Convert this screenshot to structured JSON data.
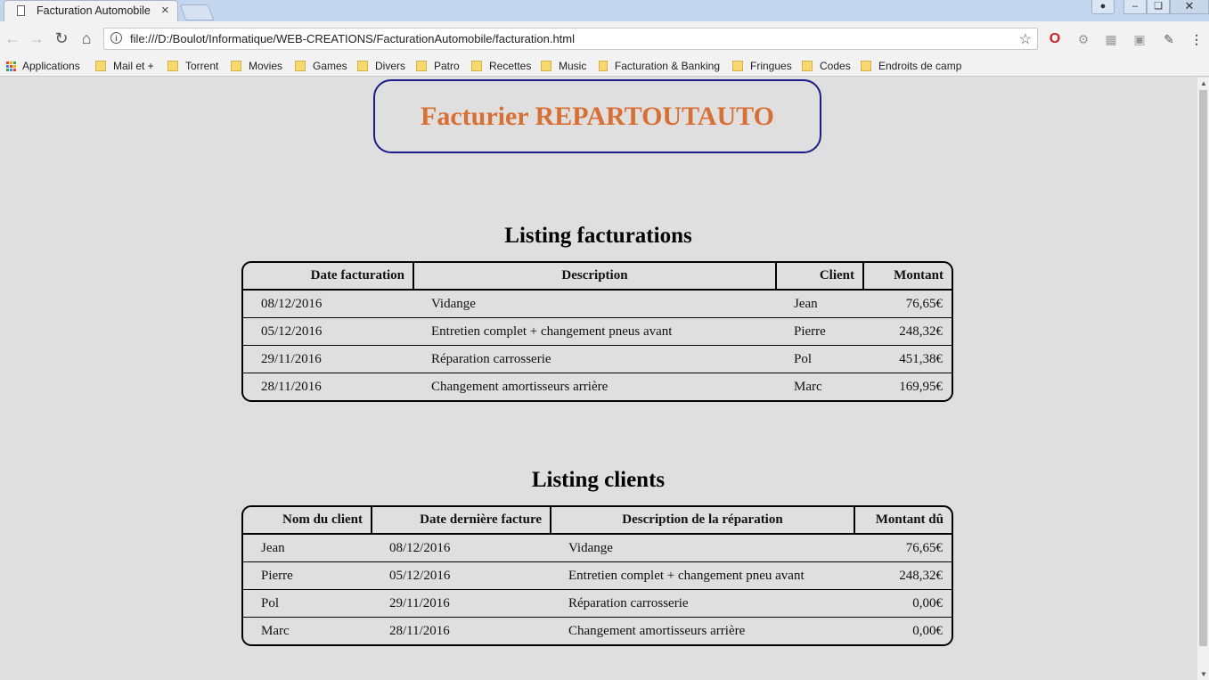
{
  "browser": {
    "tab_title": "Facturation Automobile",
    "tab_close": "×",
    "url": "file:///D:/Boulot/Informatique/WEB-CREATIONS/FacturationAutomobile/facturation.html",
    "bookmarks": [
      "Applications",
      "Mail et +",
      "Torrent",
      "Movies",
      "Games",
      "Divers",
      "Patro",
      "Recettes",
      "Music",
      "Facturation & Banking",
      "Fringues",
      "Codes",
      "Endroits de camp"
    ]
  },
  "page": {
    "title": "Facturier REPARTOUTAUTO",
    "title_color": "#d96f33",
    "border_color": "#1c1c8a"
  },
  "factures": {
    "heading": "Listing facturations",
    "headers": [
      "Date facturation",
      "Description",
      "Client",
      "Montant"
    ],
    "rows": [
      [
        "08/12/2016",
        "Vidange",
        "Jean",
        "76,65€"
      ],
      [
        "05/12/2016",
        "Entretien complet + changement pneus avant",
        "Pierre",
        "248,32€"
      ],
      [
        "29/11/2016",
        "Réparation carrosserie",
        "Pol",
        "451,38€"
      ],
      [
        "28/11/2016",
        "Changement amortisseurs arrière",
        "Marc",
        "169,95€"
      ]
    ]
  },
  "clients": {
    "heading": "Listing clients",
    "headers": [
      "Nom du client",
      "Date dernière facture",
      "Description de la réparation",
      "Montant dû"
    ],
    "rows": [
      [
        "Jean",
        "08/12/2016",
        "Vidange",
        "76,65€"
      ],
      [
        "Pierre",
        "05/12/2016",
        "Entretien complet + changement pneu avant",
        "248,32€"
      ],
      [
        "Pol",
        "29/11/2016",
        "Réparation carrosserie",
        "0,00€"
      ],
      [
        "Marc",
        "28/11/2016",
        "Changement amortisseurs arrière",
        "0,00€"
      ]
    ]
  }
}
